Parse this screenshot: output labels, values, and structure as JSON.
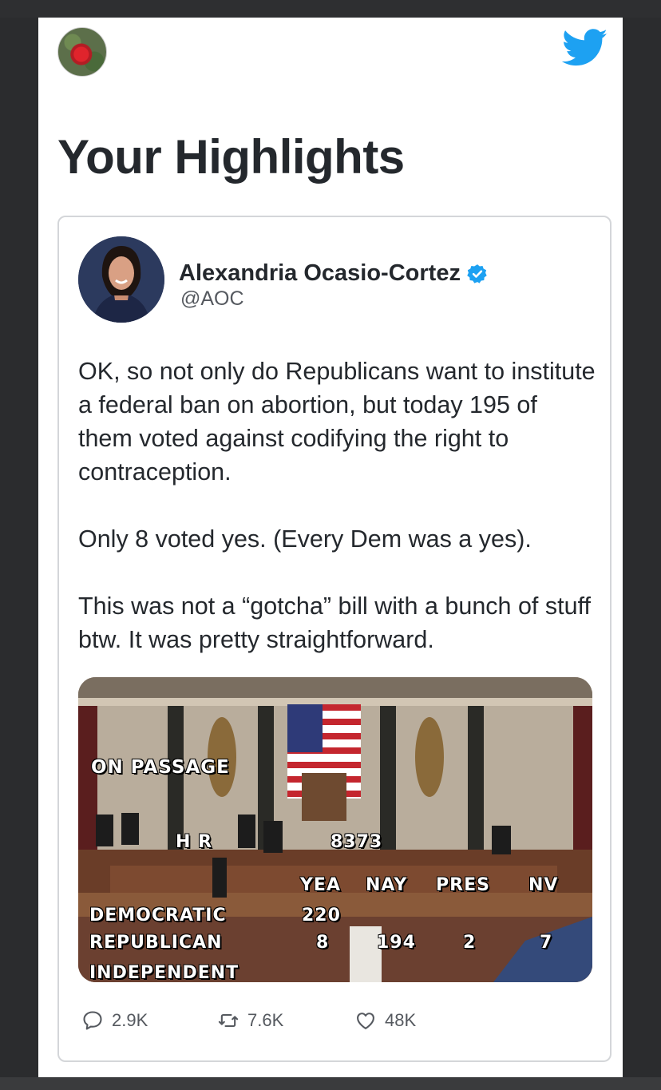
{
  "page": {
    "title": "Your Highlights",
    "colors": {
      "accent": "#1da1f2",
      "text": "#24282d",
      "muted": "#55595f",
      "border": "#d4d6d9"
    },
    "icons": {
      "app": "twitter-bird-icon",
      "verified": "verified-badge-icon"
    }
  },
  "tweet": {
    "author_name": "Alexandria Ocasio-Cortez",
    "author_handle": "@AOC",
    "verified": true,
    "paragraphs": [
      "OK, so not only do Republicans want to institute a federal ban on abortion, but today 195 of them voted against codifying the right to contraception.",
      "Only 8 voted yes. (Every Dem was a yes).",
      "This was not a “gotcha” bill with a bunch of stuff btw. It was pretty straightforward."
    ],
    "media": {
      "on_passage": "ON PASSAGE",
      "bill_label": "H R",
      "bill_number": "8373",
      "columns": [
        "YEA",
        "NAY",
        "PRES",
        "NV"
      ],
      "rows": [
        {
          "party": "DEMOCRATIC",
          "yea": "220"
        },
        {
          "party": "REPUBLICAN",
          "yea": "8",
          "nay": "194",
          "pres": "2",
          "nv": "7"
        },
        {
          "party": "INDEPENDENT"
        }
      ]
    },
    "actions": {
      "replies": "2.9K",
      "retweets": "7.6K",
      "likes": "48K"
    }
  }
}
